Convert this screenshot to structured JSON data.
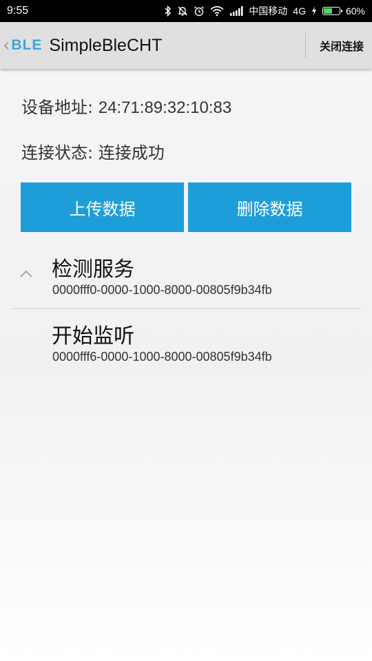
{
  "status_bar": {
    "time": "9:55",
    "carrier": "中国移动",
    "network": "4G",
    "battery": "60%",
    "battery_level": 0.6,
    "icons": [
      "bluetooth-icon",
      "mute-icon",
      "alarm-icon",
      "wifi-icon",
      "signal-icon",
      "charging-icon",
      "battery-icon"
    ]
  },
  "action_bar": {
    "logo": "BLE",
    "title": "SimpleBleCHT",
    "disconnect_label": "关闭连接"
  },
  "device": {
    "address_label": "设备地址: ",
    "address": "24:71:89:32:10:83",
    "status_label": "连接状态: ",
    "status": "连接成功"
  },
  "buttons": {
    "upload": "上传数据",
    "delete": "删除数据"
  },
  "services": [
    {
      "title": "检测服务",
      "uuid": "0000fff0-0000-1000-8000-00805f9b34fb"
    },
    {
      "title": "开始监听",
      "uuid": "0000fff6-0000-1000-8000-00805f9b34fb"
    }
  ],
  "colors": {
    "accent": "#1e9ed9",
    "logo": "#3aa6dd",
    "battery_fill": "#4cd964"
  }
}
